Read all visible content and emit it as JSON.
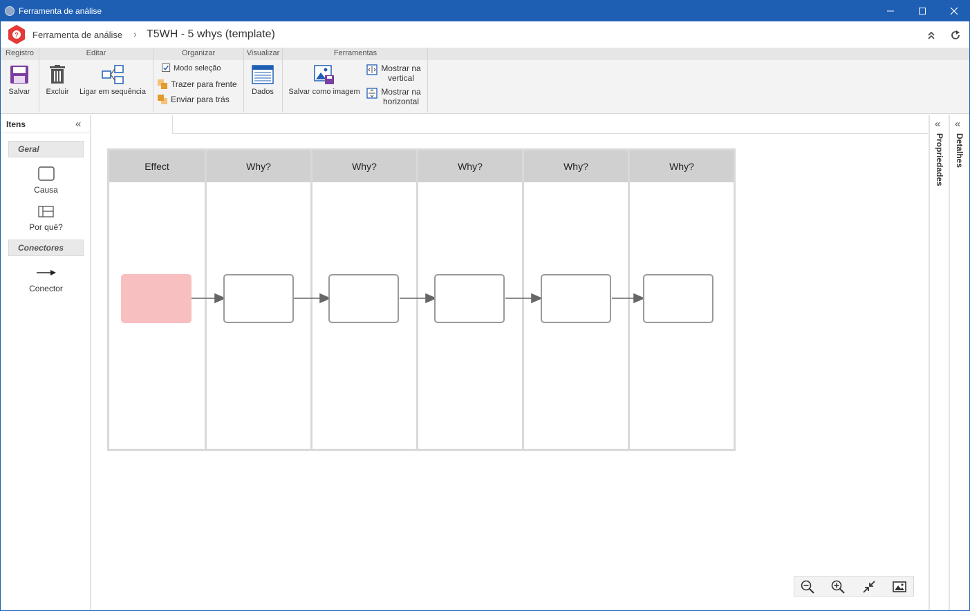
{
  "window": {
    "title": "Ferramenta de análise"
  },
  "header": {
    "breadcrumb": "Ferramenta de análise",
    "title": "T5WH - 5 whys (template)"
  },
  "ribbon": {
    "groups": {
      "registro": "Registro",
      "editar": "Editar",
      "organizar": "Organizar",
      "visualizar": "Visualizar",
      "ferramentas": "Ferramentas"
    },
    "buttons": {
      "salvar": "Salvar",
      "excluir": "Excluir",
      "ligar": "Ligar em sequência",
      "modo_selecao": "Modo seleção",
      "trazer": "Trazer para frente",
      "enviar": "Enviar para trás",
      "dados": "Dados",
      "salvar_imagem": "Salvar como imagem",
      "mostrar_vertical_1": "Mostrar na",
      "mostrar_vertical_2": "vertical",
      "mostrar_horizontal_1": "Mostrar na",
      "mostrar_horizontal_2": "horizontal"
    },
    "modo_selecao_checked": true
  },
  "left_panel": {
    "title": "Itens",
    "sections": {
      "geral": "Geral",
      "conectores": "Conectores"
    },
    "items": {
      "causa": "Causa",
      "porque": "Por quê?",
      "conector": "Conector"
    }
  },
  "diagram": {
    "lanes": [
      "Effect",
      "Why?",
      "Why?",
      "Why?",
      "Why?",
      "Why?"
    ],
    "colors": {
      "effect_fill": "#f8bfc0",
      "lane_header": "#d0d0d0",
      "node_border": "#9a9a9a"
    }
  },
  "right_panels": {
    "propriedades": "Propriedades",
    "detalhes": "Detalhes"
  },
  "colors": {
    "titlebar": "#1e5fb4",
    "accent_purple": "#7b3fa0",
    "logo_red": "#e53935"
  }
}
